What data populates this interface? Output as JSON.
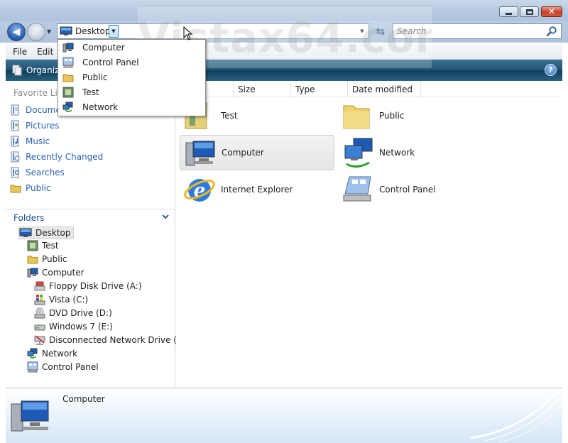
{
  "watermark": "Vistax64.com",
  "address": {
    "current": "Desktop",
    "crumb_menu": [
      {
        "label": "Computer",
        "icon": "computer-icon"
      },
      {
        "label": "Control Panel",
        "icon": "control-panel-icon"
      },
      {
        "label": "Public",
        "icon": "folder-icon"
      },
      {
        "label": "Test",
        "icon": "user-folder-icon"
      },
      {
        "label": "Network",
        "icon": "network-icon"
      }
    ]
  },
  "search": {
    "placeholder": "Search"
  },
  "menubar": {
    "file": "File",
    "edit": "Edit"
  },
  "toolbar": {
    "organize": "Organiz"
  },
  "favorites": {
    "header": "Favorite Lin",
    "items": [
      {
        "label": "Docume",
        "icon": "documents-icon"
      },
      {
        "label": "Pictures",
        "icon": "pictures-icon"
      },
      {
        "label": "Music",
        "icon": "music-icon"
      },
      {
        "label": "Recently Changed",
        "icon": "recent-icon"
      },
      {
        "label": "Searches",
        "icon": "searches-icon"
      },
      {
        "label": "Public",
        "icon": "folder-icon"
      }
    ]
  },
  "folders": {
    "header": "Folders",
    "tree": [
      {
        "label": "Desktop",
        "icon": "desktop-icon"
      },
      {
        "label": "Test",
        "icon": "user-folder-icon"
      },
      {
        "label": "Public",
        "icon": "folder-icon"
      },
      {
        "label": "Computer",
        "icon": "computer-icon"
      },
      {
        "label": "Floppy Disk Drive (A:)",
        "icon": "floppy-icon"
      },
      {
        "label": "Vista (C:)",
        "icon": "drive-icon"
      },
      {
        "label": "DVD Drive (D:)",
        "icon": "dvd-icon"
      },
      {
        "label": "Windows 7 (E:)",
        "icon": "drive-icon"
      },
      {
        "label": "Disconnected Network Drive (Z:)",
        "icon": "network-drive-icon"
      },
      {
        "label": "Network",
        "icon": "network-icon"
      },
      {
        "label": "Control Panel",
        "icon": "control-panel-icon"
      }
    ]
  },
  "columns": [
    "Size",
    "Type",
    "Date modified"
  ],
  "files": [
    {
      "label": "Test",
      "icon": "user-folder-icon"
    },
    {
      "label": "Public",
      "icon": "folder-icon"
    },
    {
      "label": "Computer",
      "icon": "computer-icon"
    },
    {
      "label": "Network",
      "icon": "network-icon"
    },
    {
      "label": "Internet Explorer",
      "icon": "ie-icon"
    },
    {
      "label": "Control Panel",
      "icon": "control-panel-icon"
    }
  ],
  "details": {
    "name": "Computer"
  }
}
